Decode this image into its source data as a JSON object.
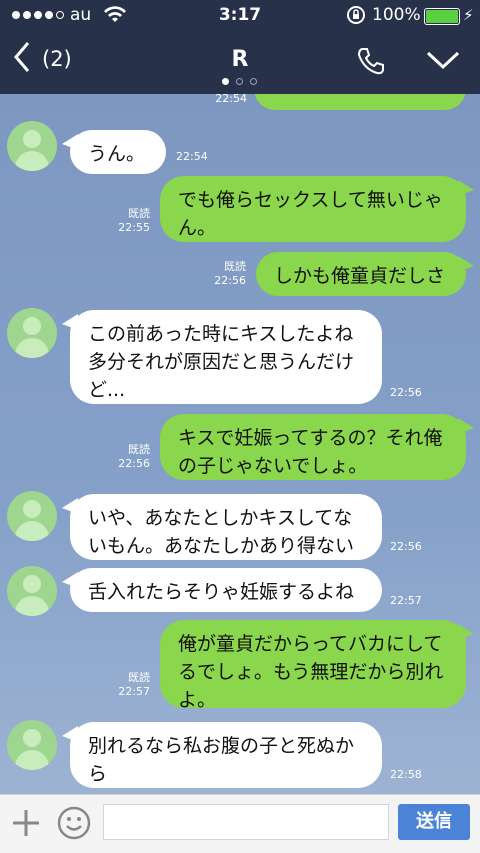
{
  "status": {
    "carrier": "au",
    "time": "3:17",
    "battery": "100%",
    "battery_level": 1.0,
    "signal_bars_filled": 4,
    "signal_bars_total": 5
  },
  "nav": {
    "back_count": "(2)",
    "title": "R",
    "page": 0,
    "pages": 3
  },
  "messages": [
    {
      "side": "out",
      "text": "",
      "time": "22:54"
    },
    {
      "side": "in",
      "text": "うん。",
      "time": "22:54"
    },
    {
      "side": "out",
      "text": "でも俺らセックスして無いじゃ\nん。",
      "time": "22:55",
      "read": "既読"
    },
    {
      "side": "out",
      "text": "しかも俺童貞だしさ",
      "time": "22:56",
      "read": "既読"
    },
    {
      "side": "in",
      "text": "この前あった時にキスしたよね\n多分それが原因だと思うんだけ\nど...",
      "time": "22:56"
    },
    {
      "side": "out",
      "text": "キスで妊娠ってするの？それ俺\nの子じゃないでしょ。",
      "time": "22:56",
      "read": "既読"
    },
    {
      "side": "in",
      "text": "いや、あなたとしかキスしてな\nいもん。あなたしかあり得ない",
      "time": "22:56"
    },
    {
      "side": "in",
      "text": "舌入れたらそりゃ妊娠するよね",
      "time": "22:57"
    },
    {
      "side": "out",
      "text": "俺が童貞だからってバカにして\nるでしょ。もう無理だから別れ\nよ。",
      "time": "22:57",
      "read": "既読"
    },
    {
      "side": "in",
      "text": "別れるなら私お腹の子と死ぬか\nら",
      "time": "22:58"
    }
  ],
  "composer": {
    "placeholder": "",
    "send_label": "送信"
  },
  "colors": {
    "bar": "#27324a",
    "outgoing": "#8ad64c",
    "incoming": "#ffffff",
    "send": "#4b84d6"
  }
}
